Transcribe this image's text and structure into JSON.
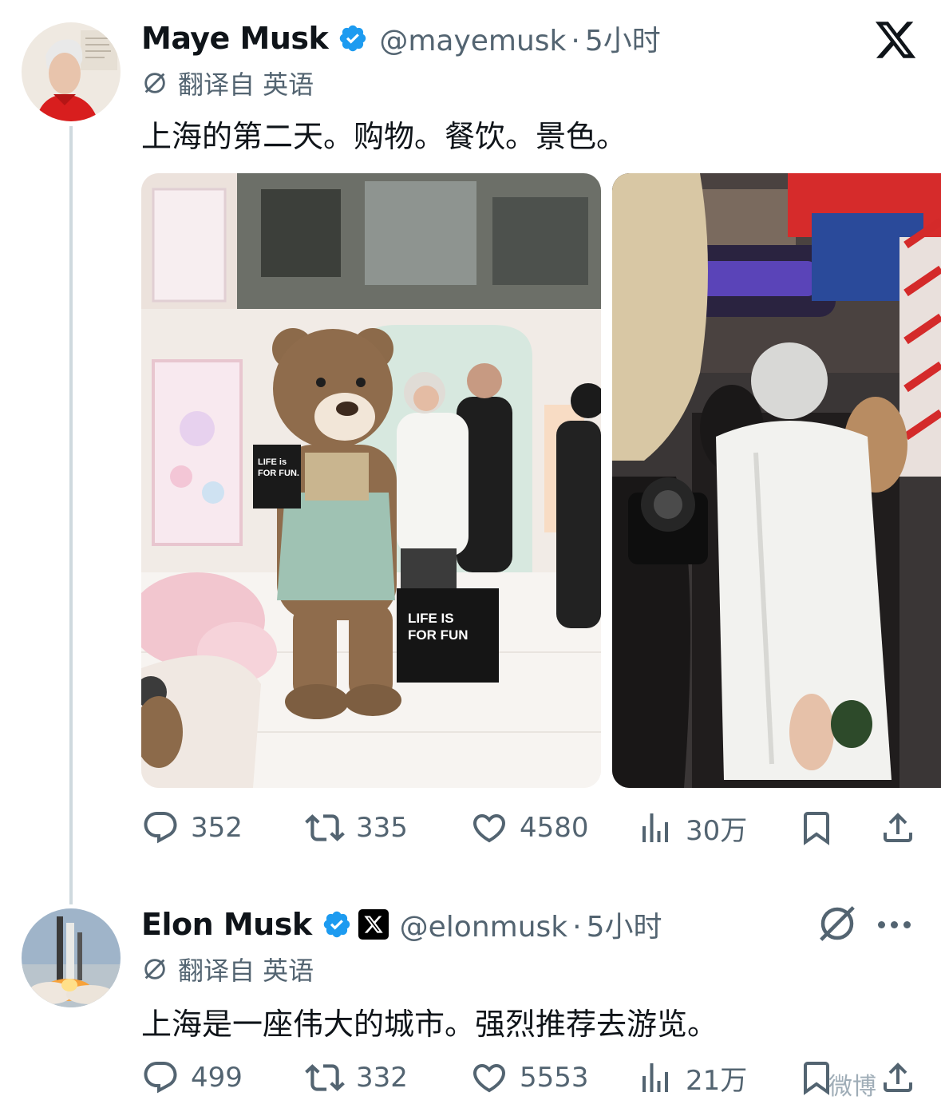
{
  "tweets": [
    {
      "display_name": "Maye Musk",
      "handle": "@mayemusk",
      "separator": "·",
      "time": "5小时",
      "translated_label": "翻译自 英语",
      "text": "上海的第二天。购物。餐饮。景色。",
      "media": [
        {
          "description_icon": "photo",
          "bag_text_1": "LIFE IS",
          "bag_text_2": "FOR FUN",
          "bag_text_small_1": "LIFE is",
          "bag_text_small_2": "FOR FUN."
        },
        {
          "description_icon": "photo"
        }
      ],
      "stats": {
        "replies": "352",
        "reposts": "335",
        "likes": "4580",
        "views": "30万"
      }
    },
    {
      "display_name": "Elon Musk",
      "handle": "@elonmusk",
      "separator": "·",
      "time": "5小时",
      "translated_label": "翻译自 英语",
      "text": "上海是一座伟大的城市。强烈推荐去游览。",
      "stats": {
        "replies": "499",
        "reposts": "332",
        "likes": "5553",
        "views": "21万"
      }
    }
  ],
  "colors": {
    "text": "#0f1419",
    "muted": "#536471",
    "verified": "#1d9bf0",
    "thread_line": "#cfd9de"
  },
  "icons": [
    "verified-badge-icon",
    "x-logo-icon",
    "translate-icon",
    "reply-icon",
    "repost-icon",
    "like-icon",
    "views-icon",
    "bookmark-icon",
    "share-icon",
    "grok-icon",
    "more-icon"
  ],
  "watermark": "微博"
}
